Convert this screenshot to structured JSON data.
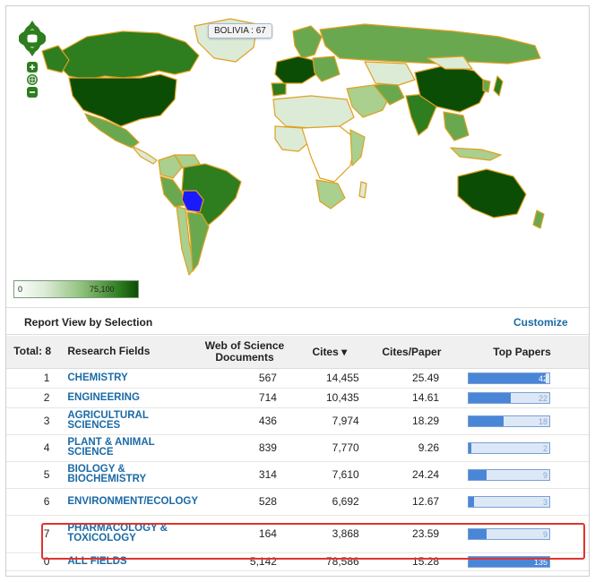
{
  "map": {
    "tooltip": "BOLIVIA : 67",
    "legend": {
      "min_label": "0",
      "max_label": "75,100"
    },
    "colors": {
      "darkest": "#0b4d05",
      "dark": "#2e7d1f",
      "mid": "#6aa84f",
      "light": "#a9d08e",
      "pale": "#dcebd6",
      "highlight": "#1a1aff",
      "border": "#e0a020"
    }
  },
  "report": {
    "title": "Report View by Selection",
    "customize": "Customize",
    "headers": {
      "rank": "Total: 8",
      "field": "Research Fields",
      "docs": "Web of Science Documents",
      "cites": "Cites ▾",
      "cites_per_paper": "Cites/Paper",
      "top_papers": "Top Papers"
    },
    "rows": [
      {
        "rank": "1",
        "field": "CHEMISTRY",
        "docs": "567",
        "cites": "14,455",
        "cpp": "25.49",
        "top_label": "42",
        "top_fraction": 0.95
      },
      {
        "rank": "2",
        "field": "ENGINEERING",
        "docs": "714",
        "cites": "10,435",
        "cpp": "14.61",
        "top_label": "22",
        "top_fraction": 0.52
      },
      {
        "rank": "3",
        "field": "AGRICULTURAL SCIENCES",
        "docs": "436",
        "cites": "7,974",
        "cpp": "18.29",
        "top_label": "18",
        "top_fraction": 0.43
      },
      {
        "rank": "4",
        "field": "PLANT & ANIMAL SCIENCE",
        "docs": "839",
        "cites": "7,770",
        "cpp": "9.26",
        "top_label": "2",
        "top_fraction": 0.03
      },
      {
        "rank": "5",
        "field": "BIOLOGY & BIOCHEMISTRY",
        "docs": "314",
        "cites": "7,610",
        "cpp": "24.24",
        "top_label": "9",
        "top_fraction": 0.22
      },
      {
        "rank": "6",
        "field": "ENVIRONMENT/ECOLOGY",
        "docs": "528",
        "cites": "6,692",
        "cpp": "12.67",
        "top_label": "3",
        "top_fraction": 0.07
      },
      {
        "rank": "7",
        "field": "PHARMACOLOGY & TOXICOLOGY",
        "docs": "164",
        "cites": "3,868",
        "cpp": "23.59",
        "top_label": "9",
        "top_fraction": 0.22
      },
      {
        "rank": "0",
        "field": "ALL FIELDS",
        "docs": "5,142",
        "cites": "78,586",
        "cpp": "15.28",
        "top_label": "135",
        "top_fraction": 1.0
      }
    ]
  }
}
